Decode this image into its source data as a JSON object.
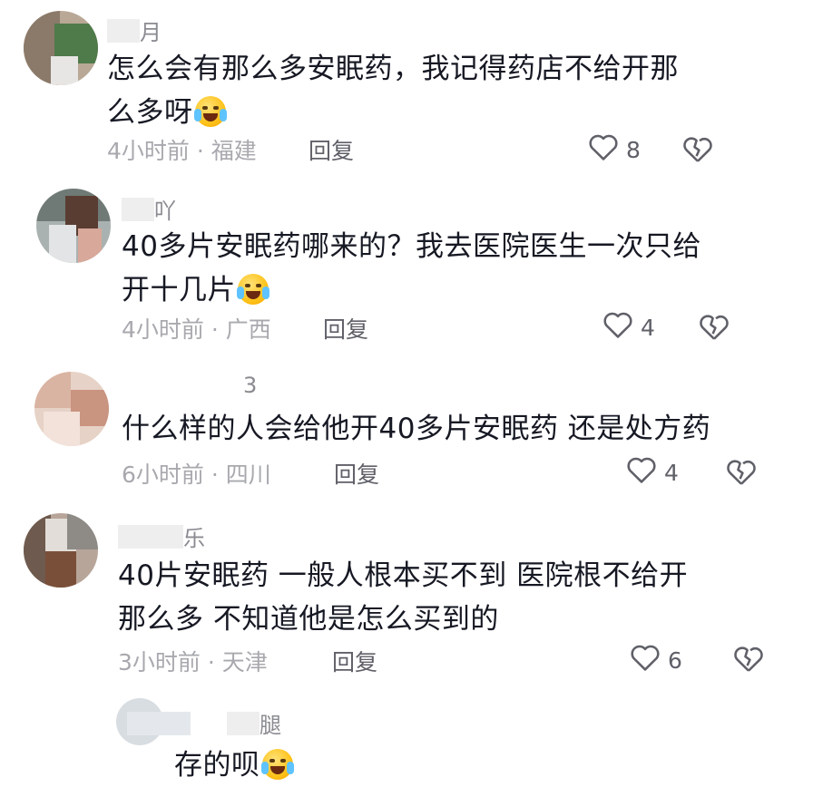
{
  "comments": [
    {
      "username": "月",
      "text_lines": [
        "怎么会有那么多安眠药，我记得药店不给开那",
        "么多呀"
      ],
      "emoji": "crying-laughing-emoji",
      "time": "4小时前",
      "location": "福建",
      "meta": "4小时前 · 福建",
      "reply_label": "回复",
      "likes": "8"
    },
    {
      "username": "吖",
      "text_lines": [
        "40多片安眠药哪来的？我去医院医生一次只给",
        "开十几片"
      ],
      "emoji": "crying-emoji",
      "meta": "4小时前 · 广西",
      "reply_label": "回复",
      "likes": "4"
    },
    {
      "username": "3",
      "text_lines": [
        "什么样的人会给他开40多片安眠药 还是处方药"
      ],
      "meta": "6小时前 · 四川",
      "reply_label": "回复",
      "likes": "4"
    },
    {
      "username": "乐",
      "text_lines": [
        "40片安眠药  一般人根本买不到  医院根不给开",
        "那么多 不知道他是怎么买到的"
      ],
      "meta": "3小时前 · 天津",
      "reply_label": "回复",
      "likes": "6"
    },
    {
      "username": "腿",
      "text_lines": [
        "存的呗"
      ],
      "emoji": "laughing-tears-emoji"
    }
  ],
  "colors": {
    "text": "#161823",
    "meta": "#a8a9ae",
    "icon": "#5f6068"
  }
}
